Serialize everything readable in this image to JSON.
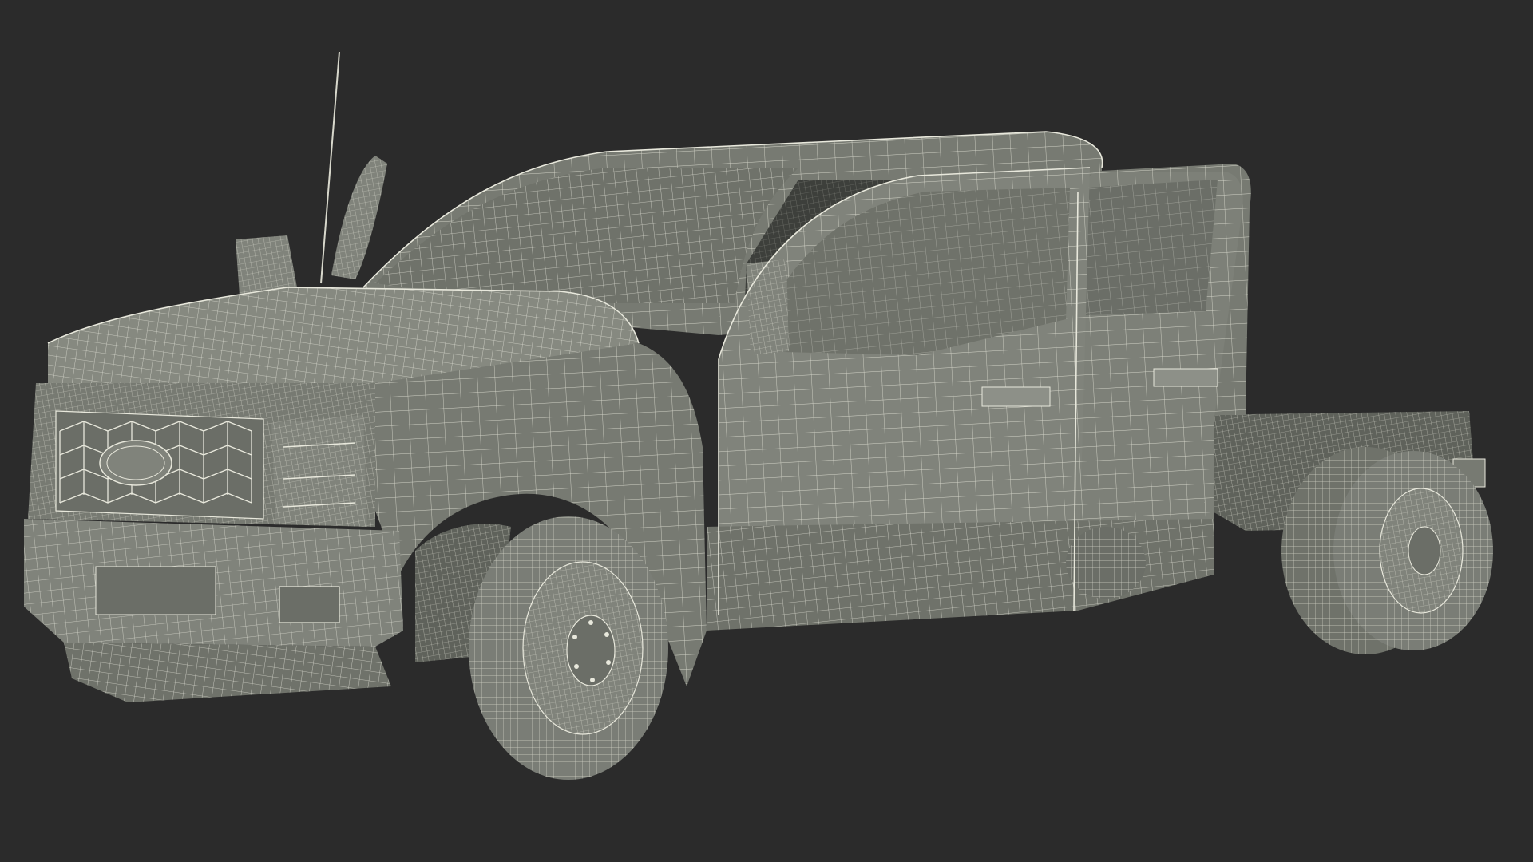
{
  "scene": {
    "subject": "truck-wireframe-render",
    "colors": {
      "background": "#2b2b2b",
      "body_fill": "#777a72",
      "body_fill_light": "#868980",
      "body_fill_dark": "#5f625b",
      "wire": "#e8e8dc",
      "tire": "#7a7d76",
      "interior": "#3d3f3b"
    }
  }
}
